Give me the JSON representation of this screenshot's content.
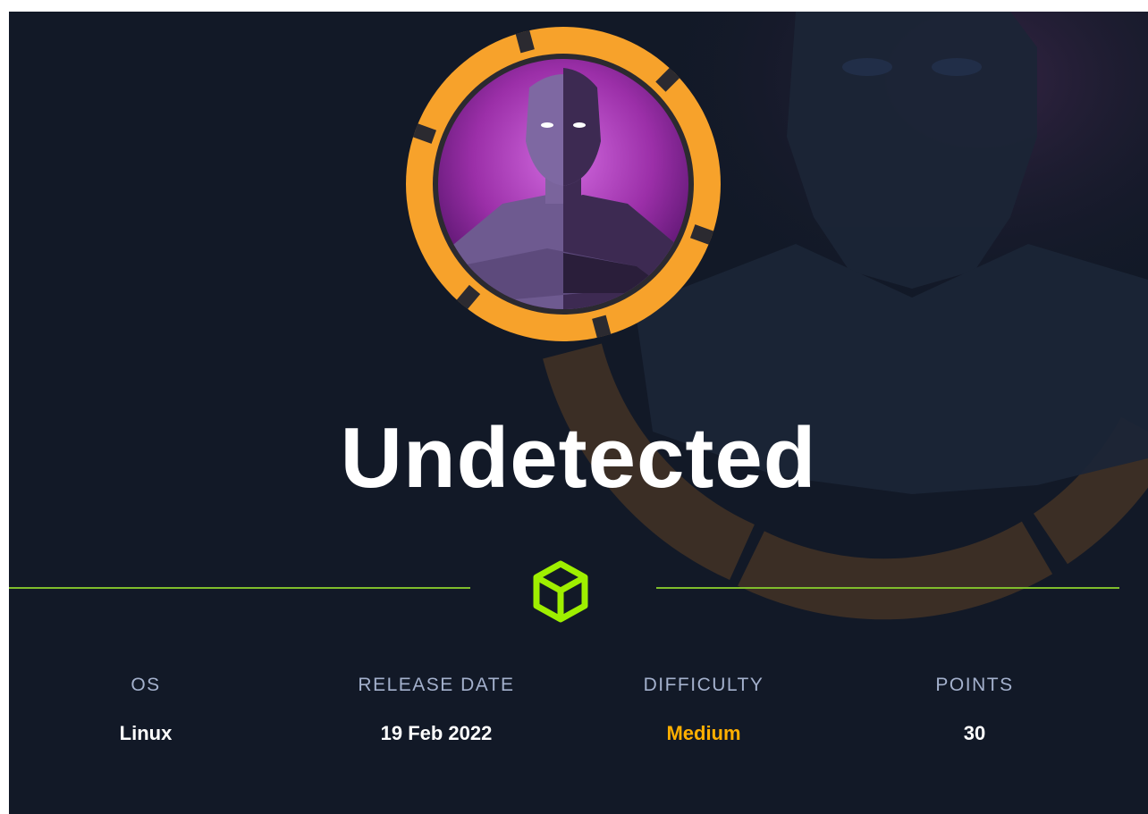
{
  "machine": {
    "name": "Undetected",
    "avatar_icon": "hooded-figure-avatar",
    "ring_color": "#f7a22b",
    "avatar_bg": "#9b2fa8"
  },
  "divider": {
    "icon": "cube-icon",
    "color": "#9fef00"
  },
  "stats": [
    {
      "label": "OS",
      "value": "Linux"
    },
    {
      "label": "RELEASE DATE",
      "value": "19 Feb 2022"
    },
    {
      "label": "DIFFICULTY",
      "value": "Medium",
      "value_color": "#ffaf00"
    },
    {
      "label": "POINTS",
      "value": "30"
    }
  ]
}
